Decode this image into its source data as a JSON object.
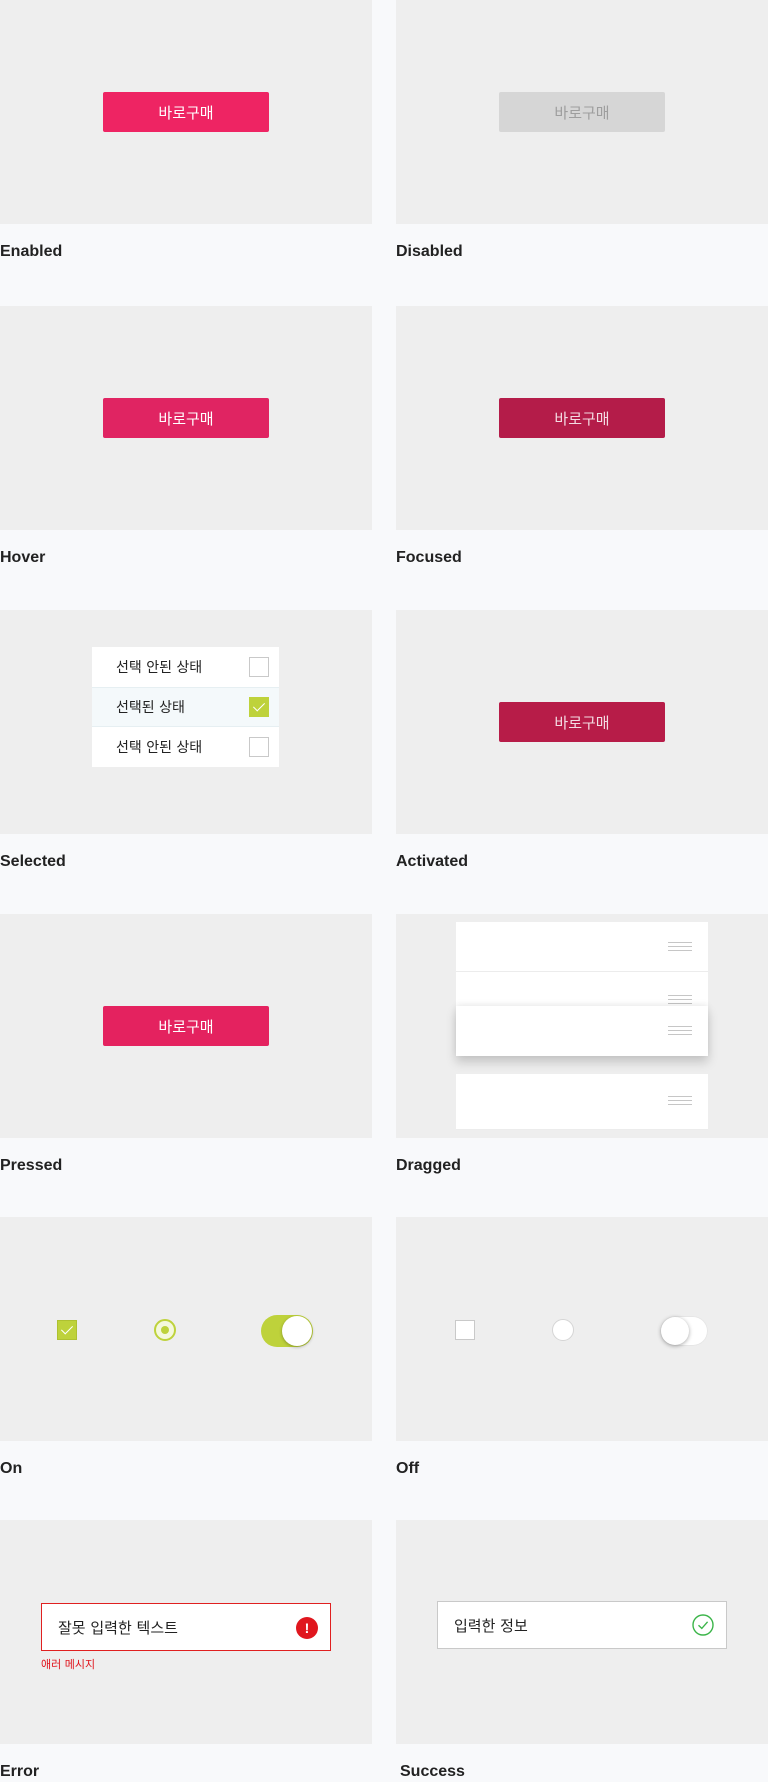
{
  "buttons": {
    "buy_label": "바로구매"
  },
  "states": {
    "enabled": "Enabled",
    "disabled": "Disabled",
    "hover": "Hover",
    "focused": "Focused",
    "selected": "Selected",
    "activated": "Activated",
    "pressed": "Pressed",
    "dragged": "Dragged",
    "on": "On",
    "off": "Off",
    "error": "Error",
    "success": "Success"
  },
  "selected_list": {
    "items": [
      {
        "label": "선택 안된 상태",
        "checked": false
      },
      {
        "label": "선택된 상태",
        "checked": true
      },
      {
        "label": "선택 안된 상태",
        "checked": false
      }
    ]
  },
  "error_field": {
    "value": "잘못 입력한 텍스트",
    "message": "애러 메시지",
    "icon": "error-icon"
  },
  "success_field": {
    "value": "입력한 정보",
    "icon": "check-circle-icon"
  },
  "colors": {
    "primary": "#ee2463",
    "primary_dark": "#b41c49",
    "accent_green": "#bed23b",
    "error": "#e0161e",
    "success": "#3cb54a",
    "panel_bg": "#eeeeee",
    "page_bg": "#f8f9fb"
  }
}
